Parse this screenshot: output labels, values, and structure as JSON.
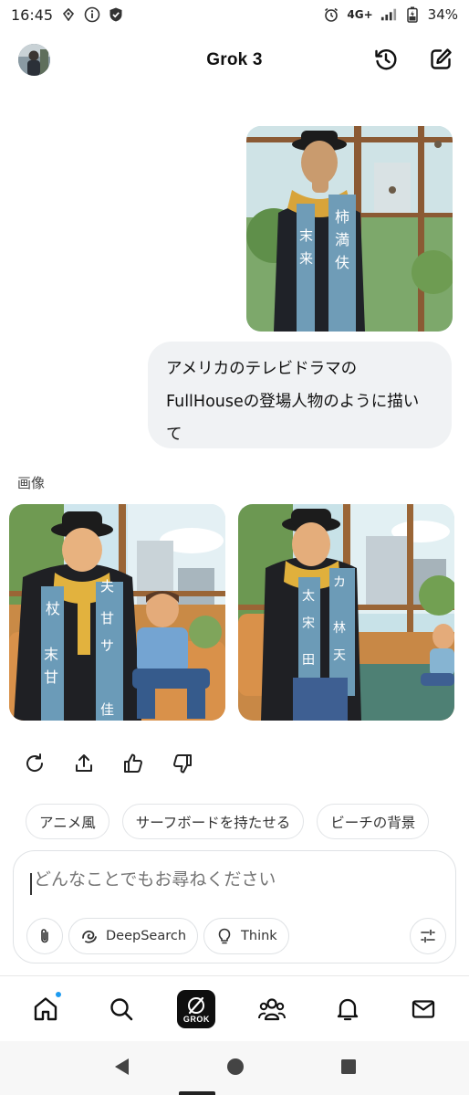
{
  "status_bar": {
    "time": "16:45",
    "network": "4G+",
    "battery": "34%",
    "icons_left": [
      "notification-icon",
      "info-icon",
      "shield-icon"
    ],
    "icons_right": [
      "alarm-icon",
      "signal-icon",
      "battery-icon"
    ]
  },
  "header": {
    "title": "Grok 3",
    "icons": [
      "avatar",
      "history-icon",
      "compose-icon"
    ]
  },
  "conversation": {
    "user_message": "アメリカのテレビドラマのFullHouseの登場人物のように描いて",
    "user_message_lines": [
      "アメリカのテレビドラマの",
      "FullHouseの登場人物のように描い",
      "て"
    ],
    "images_label": "画像"
  },
  "actions": [
    "regenerate-icon",
    "share-icon",
    "thumbs-up-icon",
    "thumbs-down-icon"
  ],
  "suggestions": [
    "アニメ風",
    "サーフボードを持たせる",
    "ビーチの背景"
  ],
  "composer": {
    "placeholder": "どんなことでもお尋ねください",
    "deepsearch_label": "DeepSearch",
    "think_label": "Think"
  },
  "bottom_nav": {
    "items": [
      "home-icon",
      "search-icon",
      "grok-icon",
      "community-icon",
      "notifications-icon",
      "messages-icon"
    ],
    "grok_label": "GROK"
  },
  "colors": {
    "accent": "#1d9bf0",
    "bubble": "#f0f2f4",
    "border": "#dfe2e5"
  }
}
